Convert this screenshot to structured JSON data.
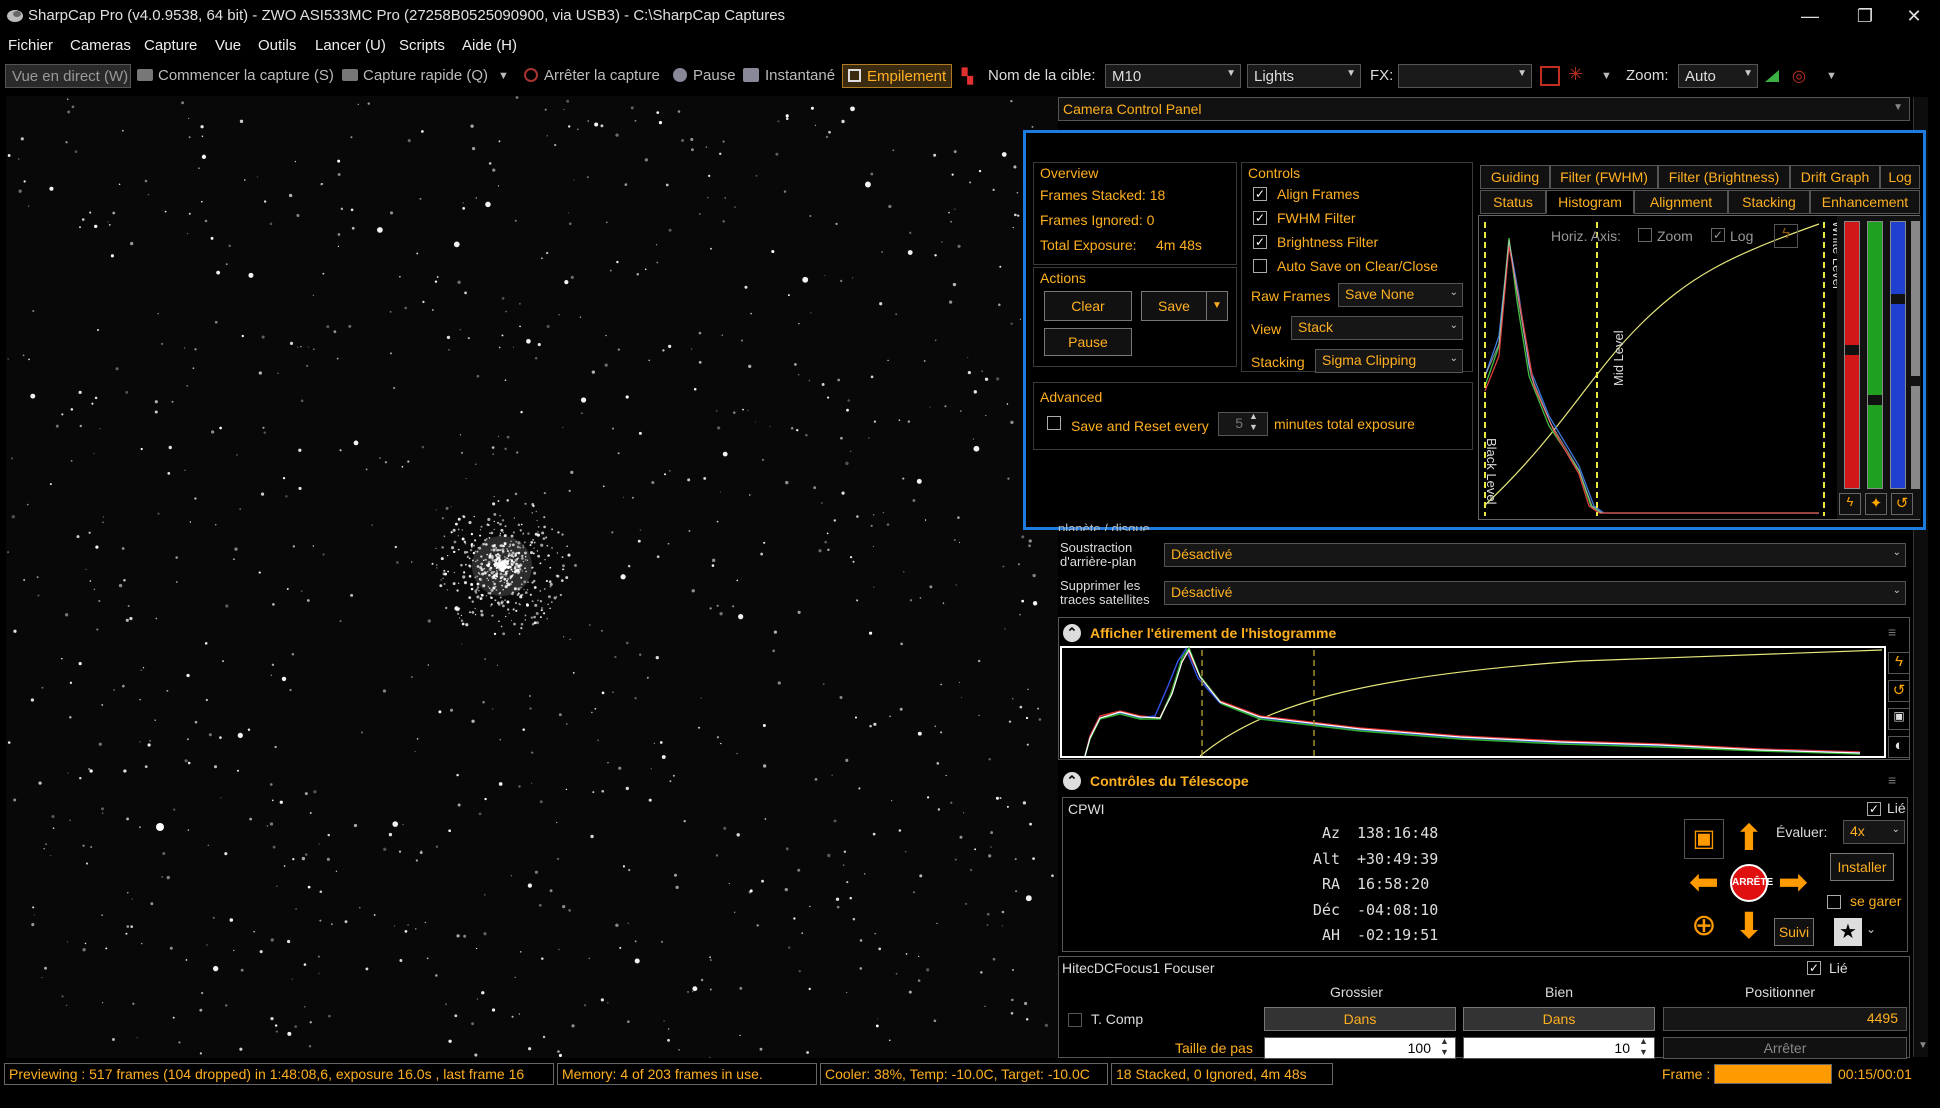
{
  "window": {
    "title": "SharpCap Pro (v4.0.9538, 64 bit) - ZWO ASI533MC Pro (27258B0525090900, via USB3) - C:\\SharpCap Captures",
    "minimize": "—",
    "restore": "❐",
    "close": "✕"
  },
  "menu": [
    "Fichier",
    "Cameras",
    "Capture",
    "Vue",
    "Outils",
    "Lancer (U)",
    "Scripts",
    "Aide (H)"
  ],
  "toolbar": {
    "live_view": "Vue en direct (W)",
    "start_capture": "Commencer la capture (S)",
    "quick_capture": "Capture rapide (Q)",
    "stop_capture": "Arrêter la capture",
    "pause": "Pause",
    "snapshot": "Instantané",
    "stacking": "Empilement",
    "target_label": "Nom de la cible:",
    "target_value": "M10",
    "frame_type": "Lights",
    "fx_label": "FX:",
    "fx_value": "",
    "zoom_label": "Zoom:",
    "zoom_value": "Auto"
  },
  "camera_panel": {
    "title": "Camera Control Panel"
  },
  "stack_overlay": {
    "overview_title": "Overview",
    "frames_stacked": "Frames Stacked: 18",
    "frames_ignored": "Frames Ignored: 0",
    "total_exposure_label": "Total Exposure:",
    "total_exposure_value": "4m 48s",
    "actions_title": "Actions",
    "clear": "Clear",
    "save": "Save",
    "pause": "Pause",
    "advanced_title": "Advanced",
    "save_reset_label": "Save and Reset every",
    "save_reset_value": "5",
    "save_reset_suffix": "minutes total exposure",
    "controls_title": "Controls",
    "align_frames": "Align Frames",
    "fwhm_filter": "FWHM Filter",
    "brightness_filter": "Brightness Filter",
    "auto_save": "Auto Save on Clear/Close",
    "raw_frames_label": "Raw Frames",
    "raw_frames_value": "Save None",
    "view_label": "View",
    "view_value": "Stack",
    "stacking_label": "Stacking",
    "stacking_value": "Sigma Clipping",
    "tabs_row1": [
      "Guiding",
      "Filter (FWHM)",
      "Filter (Brightness)",
      "Drift Graph",
      "Log"
    ],
    "tabs_row2": [
      "Status",
      "Histogram",
      "Alignment",
      "Stacking",
      "Enhancement"
    ],
    "active_tab": "Histogram",
    "hist_horiz_axis": "Horiz. Axis:",
    "hist_zoom": "Zoom",
    "hist_log": "Log",
    "black_level": "Black Level",
    "mid_level": "Mid Level",
    "white_level": "White Level"
  },
  "processing": {
    "partial_label": "planète / disque",
    "bg_sub_label": "Soustraction d'arrière-plan",
    "bg_sub_value": "Désactivé",
    "sat_label": "Supprimer les traces satellites",
    "sat_value": "Désactivé"
  },
  "histogram_stretch": {
    "title": "Afficher l'étirement de l'histogramme"
  },
  "telescope": {
    "title": "Contrôles du Télescope",
    "device": "CPWI",
    "linked_label": "Lié",
    "coords": [
      {
        "label": "Az",
        "value": "138:16:48"
      },
      {
        "label": "Alt",
        "value": "+30:49:39"
      },
      {
        "label": "RA",
        "value": "16:58:20"
      },
      {
        "label": "Déc",
        "value": "-04:08:10"
      },
      {
        "label": "AH",
        "value": "-02:19:51"
      }
    ],
    "stop_label": "ARRÊTE",
    "rate_label": "Évaluer:",
    "rate_value": "4x",
    "install_label": "Installer",
    "park_label": "se garer",
    "track_label": "Suivi"
  },
  "focuser": {
    "title": "HitecDCFocus1 Focuser",
    "linked_label": "Lié",
    "coarse_label": "Grossier",
    "fine_label": "Bien",
    "position_label": "Positionner",
    "tcomp_label": "T. Comp",
    "coarse_in": "Dans",
    "fine_in": "Dans",
    "position_value": "4495",
    "step_label": "Taille de pas",
    "coarse_step": "100",
    "fine_step": "10",
    "stop_label": "Arrêter"
  },
  "status": {
    "preview": "Previewing : 517 frames (104 dropped) in 1:48:08,6, exposure 16.0s , last frame 16",
    "memory": "Memory: 4 of 203 frames in use.",
    "cooler": "Cooler: 38%, Temp: -10.0C, Target: -10.0C",
    "stacked": "18 Stacked, 0 Ignored, 4m 48s",
    "frame_label": "Frame :",
    "frame_time": "00:15/00:01"
  },
  "colors": {
    "accent": "#ffb020",
    "highlight_border": "#1e7be0",
    "stop_red": "#e01010",
    "arrow_orange": "#ff9a00"
  }
}
